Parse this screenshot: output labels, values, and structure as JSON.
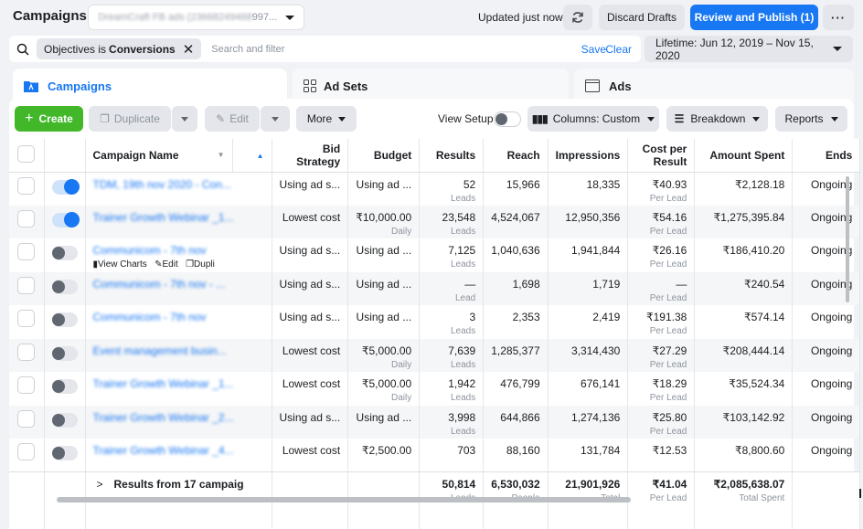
{
  "header": {
    "title": "Campaigns",
    "account_name_visible_suffix": "997...",
    "account_name_blurred": "DreamCraft FB ads (23668249468",
    "updated_status": "Updated just now",
    "discard_label": "Discard Drafts",
    "publish_label": "Review and Publish (1)",
    "more_label": "···"
  },
  "filter": {
    "chip_prefix": "Objectives is",
    "chip_value": "Conversions",
    "search_placeholder": "Search and filter",
    "save_label": "Save",
    "clear_label": "Clear",
    "date_range": "Lifetime: Jun 12, 2019 – Nov 15, 2020"
  },
  "tabs": [
    {
      "label": "Campaigns",
      "active": true
    },
    {
      "label": "Ad Sets",
      "active": false
    },
    {
      "label": "Ads",
      "active": false
    }
  ],
  "toolbar": {
    "create_label": "Create",
    "duplicate_label": "Duplicate",
    "edit_label": "Edit",
    "more_label": "More",
    "view_setup_label": "View Setup",
    "columns_label": "Columns: Custom",
    "breakdown_label": "Breakdown",
    "reports_label": "Reports"
  },
  "table": {
    "columns": [
      "Campaign Name",
      "",
      "Bid Strategy",
      "Budget",
      "Results",
      "Reach",
      "Impressions",
      "Cost per Result",
      "Amount Spent",
      "Ends"
    ],
    "hover_actions": {
      "view_charts": "View Charts",
      "edit": "Edit",
      "duplicate": "Dupli"
    },
    "rows": [
      {
        "on": true,
        "name": "TDM, 19th nov 2020 - Con...",
        "bid": "Using ad s...",
        "budget": "Using ad ...",
        "budget_sub": "",
        "results": "52",
        "results_sub": "Leads",
        "reach": "15,966",
        "impressions": "18,335",
        "cpr": "₹40.93",
        "cpr_sub": "Per Lead",
        "spent": "₹2,128.18",
        "ends": "Ongoing"
      },
      {
        "on": true,
        "name": "Trainer Growth Webinar _1...",
        "bid": "Lowest cost",
        "budget": "₹10,000.00",
        "budget_sub": "Daily",
        "results": "23,548",
        "results_sub": "Leads",
        "reach": "4,524,067",
        "impressions": "12,950,356",
        "cpr": "₹54.16",
        "cpr_sub": "Per Lead",
        "spent": "₹1,275,395.84",
        "ends": "Ongoing"
      },
      {
        "on": false,
        "name": "Communicom - 7th nov",
        "bid": "Using ad s...",
        "budget": "Using ad ...",
        "budget_sub": "",
        "results": "7,125",
        "results_sub": "Leads",
        "reach": "1,040,636",
        "impressions": "1,941,844",
        "cpr": "₹26.16",
        "cpr_sub": "Per Lead",
        "spent": "₹186,410.20",
        "ends": "Ongoing",
        "hover": true
      },
      {
        "on": false,
        "name": "Communicom - 7th nov - ...",
        "bid": "Using ad s...",
        "budget": "Using ad ...",
        "budget_sub": "",
        "results": "—",
        "results_sub": "Lead",
        "reach": "1,698",
        "impressions": "1,719",
        "cpr": "—",
        "cpr_sub": "Per Lead",
        "spent": "₹240.54",
        "ends": "Ongoing"
      },
      {
        "on": false,
        "name": "Communicom - 7th nov",
        "bid": "Using ad s...",
        "budget": "Using ad ...",
        "budget_sub": "",
        "results": "3",
        "results_sub": "Leads",
        "reach": "2,353",
        "impressions": "2,419",
        "cpr": "₹191.38",
        "cpr_sub": "Per Lead",
        "spent": "₹574.14",
        "ends": "Ongoing"
      },
      {
        "on": false,
        "name": "Event management busin...",
        "bid": "Lowest cost",
        "budget": "₹5,000.00",
        "budget_sub": "Daily",
        "results": "7,639",
        "results_sub": "Leads",
        "reach": "1,285,377",
        "impressions": "3,314,430",
        "cpr": "₹27.29",
        "cpr_sub": "Per Lead",
        "spent": "₹208,444.14",
        "ends": "Ongoing"
      },
      {
        "on": false,
        "name": "Trainer Growth Webinar _1...",
        "bid": "Lowest cost",
        "budget": "₹5,000.00",
        "budget_sub": "Daily",
        "results": "1,942",
        "results_sub": "Leads",
        "reach": "476,799",
        "impressions": "676,141",
        "cpr": "₹18.29",
        "cpr_sub": "Per Lead",
        "spent": "₹35,524.34",
        "ends": "Ongoing"
      },
      {
        "on": false,
        "name": "Trainer Growth Webinar _2...",
        "bid": "Using ad s...",
        "budget": "Using ad ...",
        "budget_sub": "",
        "results": "3,998",
        "results_sub": "Leads",
        "reach": "644,866",
        "impressions": "1,274,136",
        "cpr": "₹25.80",
        "cpr_sub": "Per Lead",
        "spent": "₹103,142.92",
        "ends": "Ongoing"
      },
      {
        "on": false,
        "name": "Trainer Growth Webinar _4...",
        "bid": "Lowest cost",
        "budget": "₹2,500.00",
        "budget_sub": "",
        "results": "703",
        "results_sub": "",
        "reach": "88,160",
        "impressions": "131,784",
        "cpr": "₹12.53",
        "cpr_sub": "",
        "spent": "₹8,800.60",
        "ends": "Ongoing"
      }
    ],
    "footer": {
      "label": "Results from 17 campaig",
      "results": "50,814",
      "results_sub": "Leads",
      "reach": "6,530,032",
      "reach_sub": "People",
      "impressions": "21,901,926",
      "impressions_sub": "Total",
      "cpr": "₹41.04",
      "cpr_sub": "Per Lead",
      "spent": "₹2,085,638.07",
      "spent_sub": "Total Spent"
    }
  },
  "colors": {
    "accent": "#1877f2",
    "create": "#42b72a"
  }
}
